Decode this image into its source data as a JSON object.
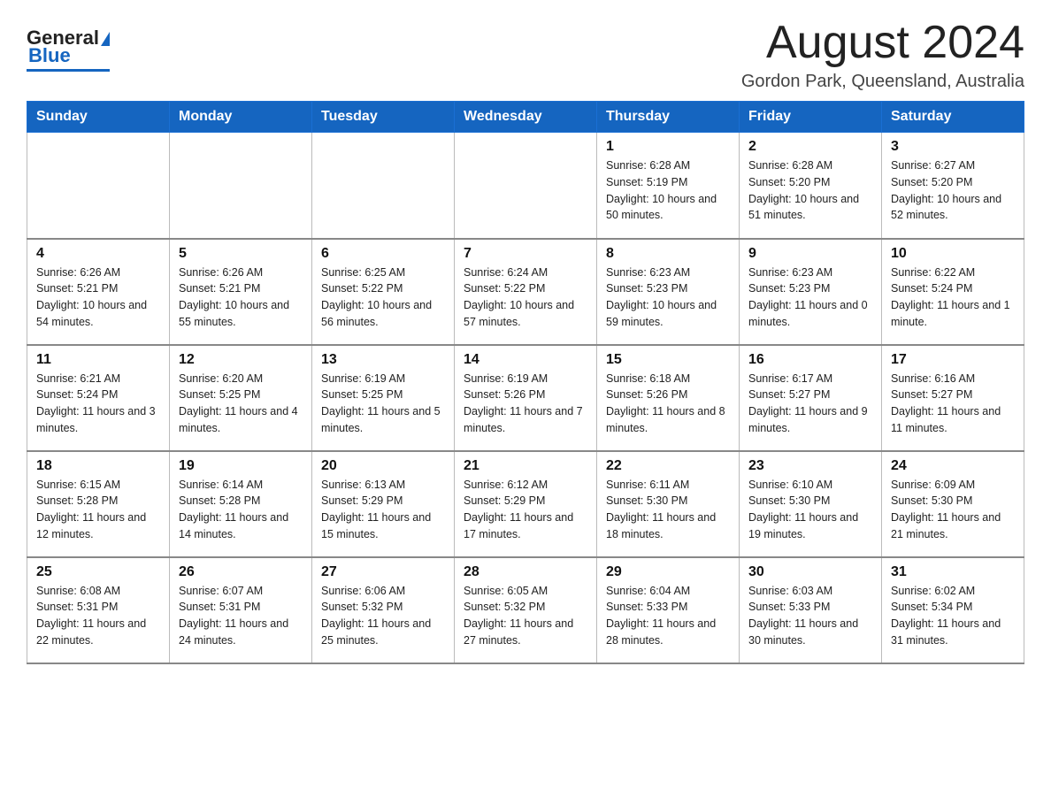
{
  "header": {
    "logo_general": "General",
    "logo_blue": "Blue",
    "month_title": "August 2024",
    "location": "Gordon Park, Queensland, Australia"
  },
  "days_of_week": [
    "Sunday",
    "Monday",
    "Tuesday",
    "Wednesday",
    "Thursday",
    "Friday",
    "Saturday"
  ],
  "weeks": [
    [
      {
        "day": "",
        "info": ""
      },
      {
        "day": "",
        "info": ""
      },
      {
        "day": "",
        "info": ""
      },
      {
        "day": "",
        "info": ""
      },
      {
        "day": "1",
        "info": "Sunrise: 6:28 AM\nSunset: 5:19 PM\nDaylight: 10 hours and 50 minutes."
      },
      {
        "day": "2",
        "info": "Sunrise: 6:28 AM\nSunset: 5:20 PM\nDaylight: 10 hours and 51 minutes."
      },
      {
        "day": "3",
        "info": "Sunrise: 6:27 AM\nSunset: 5:20 PM\nDaylight: 10 hours and 52 minutes."
      }
    ],
    [
      {
        "day": "4",
        "info": "Sunrise: 6:26 AM\nSunset: 5:21 PM\nDaylight: 10 hours and 54 minutes."
      },
      {
        "day": "5",
        "info": "Sunrise: 6:26 AM\nSunset: 5:21 PM\nDaylight: 10 hours and 55 minutes."
      },
      {
        "day": "6",
        "info": "Sunrise: 6:25 AM\nSunset: 5:22 PM\nDaylight: 10 hours and 56 minutes."
      },
      {
        "day": "7",
        "info": "Sunrise: 6:24 AM\nSunset: 5:22 PM\nDaylight: 10 hours and 57 minutes."
      },
      {
        "day": "8",
        "info": "Sunrise: 6:23 AM\nSunset: 5:23 PM\nDaylight: 10 hours and 59 minutes."
      },
      {
        "day": "9",
        "info": "Sunrise: 6:23 AM\nSunset: 5:23 PM\nDaylight: 11 hours and 0 minutes."
      },
      {
        "day": "10",
        "info": "Sunrise: 6:22 AM\nSunset: 5:24 PM\nDaylight: 11 hours and 1 minute."
      }
    ],
    [
      {
        "day": "11",
        "info": "Sunrise: 6:21 AM\nSunset: 5:24 PM\nDaylight: 11 hours and 3 minutes."
      },
      {
        "day": "12",
        "info": "Sunrise: 6:20 AM\nSunset: 5:25 PM\nDaylight: 11 hours and 4 minutes."
      },
      {
        "day": "13",
        "info": "Sunrise: 6:19 AM\nSunset: 5:25 PM\nDaylight: 11 hours and 5 minutes."
      },
      {
        "day": "14",
        "info": "Sunrise: 6:19 AM\nSunset: 5:26 PM\nDaylight: 11 hours and 7 minutes."
      },
      {
        "day": "15",
        "info": "Sunrise: 6:18 AM\nSunset: 5:26 PM\nDaylight: 11 hours and 8 minutes."
      },
      {
        "day": "16",
        "info": "Sunrise: 6:17 AM\nSunset: 5:27 PM\nDaylight: 11 hours and 9 minutes."
      },
      {
        "day": "17",
        "info": "Sunrise: 6:16 AM\nSunset: 5:27 PM\nDaylight: 11 hours and 11 minutes."
      }
    ],
    [
      {
        "day": "18",
        "info": "Sunrise: 6:15 AM\nSunset: 5:28 PM\nDaylight: 11 hours and 12 minutes."
      },
      {
        "day": "19",
        "info": "Sunrise: 6:14 AM\nSunset: 5:28 PM\nDaylight: 11 hours and 14 minutes."
      },
      {
        "day": "20",
        "info": "Sunrise: 6:13 AM\nSunset: 5:29 PM\nDaylight: 11 hours and 15 minutes."
      },
      {
        "day": "21",
        "info": "Sunrise: 6:12 AM\nSunset: 5:29 PM\nDaylight: 11 hours and 17 minutes."
      },
      {
        "day": "22",
        "info": "Sunrise: 6:11 AM\nSunset: 5:30 PM\nDaylight: 11 hours and 18 minutes."
      },
      {
        "day": "23",
        "info": "Sunrise: 6:10 AM\nSunset: 5:30 PM\nDaylight: 11 hours and 19 minutes."
      },
      {
        "day": "24",
        "info": "Sunrise: 6:09 AM\nSunset: 5:30 PM\nDaylight: 11 hours and 21 minutes."
      }
    ],
    [
      {
        "day": "25",
        "info": "Sunrise: 6:08 AM\nSunset: 5:31 PM\nDaylight: 11 hours and 22 minutes."
      },
      {
        "day": "26",
        "info": "Sunrise: 6:07 AM\nSunset: 5:31 PM\nDaylight: 11 hours and 24 minutes."
      },
      {
        "day": "27",
        "info": "Sunrise: 6:06 AM\nSunset: 5:32 PM\nDaylight: 11 hours and 25 minutes."
      },
      {
        "day": "28",
        "info": "Sunrise: 6:05 AM\nSunset: 5:32 PM\nDaylight: 11 hours and 27 minutes."
      },
      {
        "day": "29",
        "info": "Sunrise: 6:04 AM\nSunset: 5:33 PM\nDaylight: 11 hours and 28 minutes."
      },
      {
        "day": "30",
        "info": "Sunrise: 6:03 AM\nSunset: 5:33 PM\nDaylight: 11 hours and 30 minutes."
      },
      {
        "day": "31",
        "info": "Sunrise: 6:02 AM\nSunset: 5:34 PM\nDaylight: 11 hours and 31 minutes."
      }
    ]
  ]
}
